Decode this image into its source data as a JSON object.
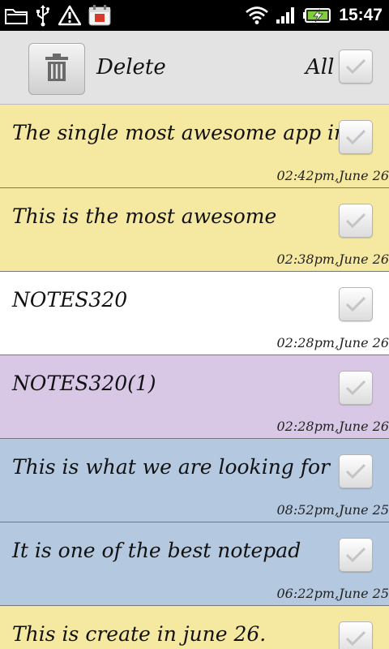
{
  "status_bar": {
    "time": "15:47",
    "icons": [
      "folder-icon",
      "usb-icon",
      "warning-icon",
      "calendar-icon",
      "wifi-icon",
      "signal-icon",
      "battery-charging-icon"
    ]
  },
  "toolbar": {
    "delete_label": "Delete",
    "all_label": "All"
  },
  "notes": [
    {
      "title": "The single most awesome app in",
      "time": "02:42pm,June 26",
      "color": "#f5e8a0"
    },
    {
      "title": "This is the most awesome",
      "time": "02:38pm,June 26",
      "color": "#f5e8a0"
    },
    {
      "title": "NOTES320",
      "time": "02:28pm,June 26",
      "color": "#ffffff"
    },
    {
      "title": "NOTES320(1)",
      "time": "02:28pm,June 26",
      "color": "#d8c8e6"
    },
    {
      "title": "This is what we are looking for",
      "time": "08:52pm,June 25",
      "color": "#b4c8e0"
    },
    {
      "title": "It is one of the best notepad",
      "time": "06:22pm,June 25",
      "color": "#b4c8e0"
    },
    {
      "title": "This is create in june 26.",
      "time": "",
      "color": "#f5e8a0"
    }
  ],
  "colors": {
    "status_bar_bg": "#000000",
    "toolbar_bg": "#e3e3e3",
    "note_yellow": "#f5e8a0",
    "note_white": "#ffffff",
    "note_purple": "#d8c8e6",
    "note_blue": "#b4c8e0"
  }
}
